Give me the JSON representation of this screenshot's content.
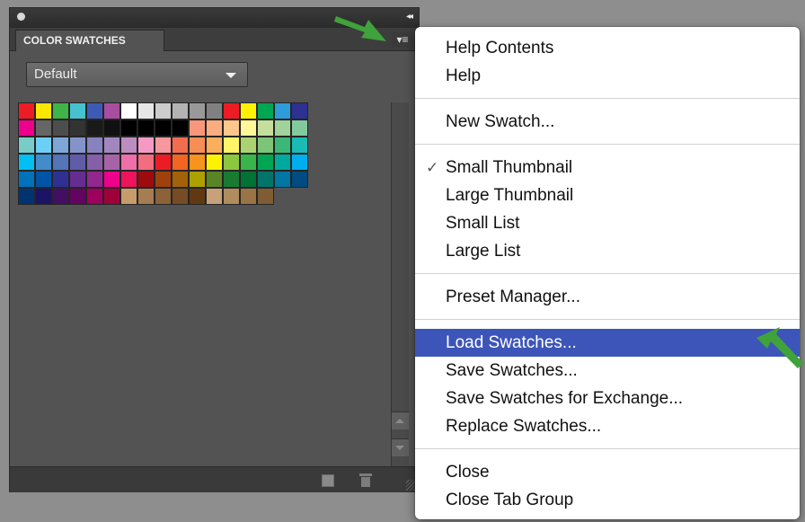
{
  "panel": {
    "tab_label": "COLOR SWATCHES",
    "collapse_glyph": "◂◂",
    "menu_button_glyph": "▾≡",
    "preset_value": "Default"
  },
  "colors": {
    "menu_highlight": "#3d55b8",
    "arrow_green": "#3fa23a",
    "panel_bg": "#535353"
  },
  "swatches": [
    [
      "#ee1c24",
      "#ffe800",
      "#3fb449",
      "#46c2cf",
      "#3d5bb5",
      "#a84d9f",
      "#ffffff",
      "#e6e6e6",
      "#cccccc",
      "#b3b3b3",
      "#999999",
      "#808080",
      "#ed1c24",
      "#fff200",
      "#00a651",
      "#2e9cd8",
      "#2e3192"
    ],
    [
      "#ec008c",
      "#666666",
      "#4d4d4d",
      "#333333",
      "#1a1a1a",
      "#111111",
      "#000000",
      "#000000",
      "#000000",
      "#000000",
      "#f7977a",
      "#f9ad81",
      "#fdc68a",
      "#fff79a",
      "#c4df9b",
      "#a2d39c",
      "#82ca9d"
    ],
    [
      "#7accc8",
      "#6ecff6",
      "#7ea7d8",
      "#8493ca",
      "#8882be",
      "#a187be",
      "#bc8dbf",
      "#f49ac2",
      "#f6989d",
      "#f26c4f",
      "#f68e55",
      "#fbaf5c",
      "#fff467",
      "#acd372",
      "#7cc576",
      "#3bb878",
      "#1abbb4"
    ],
    [
      "#00bff3",
      "#438ccb",
      "#5574b9",
      "#605ca8",
      "#855fa8",
      "#a763a8",
      "#f06eaa",
      "#f26d7d",
      "#ed1c24",
      "#f26522",
      "#f7941d",
      "#fff200",
      "#8dc73f",
      "#39b54a",
      "#00a651",
      "#00a99d",
      "#00aeef"
    ],
    [
      "#0072bc",
      "#0054a6",
      "#2e3192",
      "#662d91",
      "#92278f",
      "#ec008c",
      "#ed145b",
      "#9e0b0f",
      "#a0410d",
      "#a36209",
      "#aba000",
      "#598527",
      "#197b30",
      "#007236",
      "#00746b",
      "#0076a3",
      "#004b80"
    ],
    [
      "#003471",
      "#1b1464",
      "#440e62",
      "#630460",
      "#9e005d",
      "#9e0039",
      "#c69c6d",
      "#a67c52",
      "#8c6239",
      "#754c24",
      "#603913",
      "#c7a17a",
      "#b08c5e",
      "#9a7444",
      "#805c34"
    ]
  ],
  "menu": {
    "groups": [
      [
        {
          "label": "Help Contents"
        },
        {
          "label": "Help"
        }
      ],
      [
        {
          "label": "New Swatch..."
        }
      ],
      [
        {
          "label": "Small Thumbnail",
          "checked": true
        },
        {
          "label": "Large Thumbnail"
        },
        {
          "label": "Small List"
        },
        {
          "label": "Large List"
        }
      ],
      [
        {
          "label": "Preset Manager..."
        }
      ],
      [
        {
          "label": "Load Swatches...",
          "highlighted": true
        },
        {
          "label": "Save Swatches..."
        },
        {
          "label": "Save Swatches for Exchange..."
        },
        {
          "label": "Replace Swatches..."
        }
      ],
      [
        {
          "label": "Close"
        },
        {
          "label": "Close Tab Group"
        }
      ]
    ],
    "check_glyph": "✓"
  }
}
